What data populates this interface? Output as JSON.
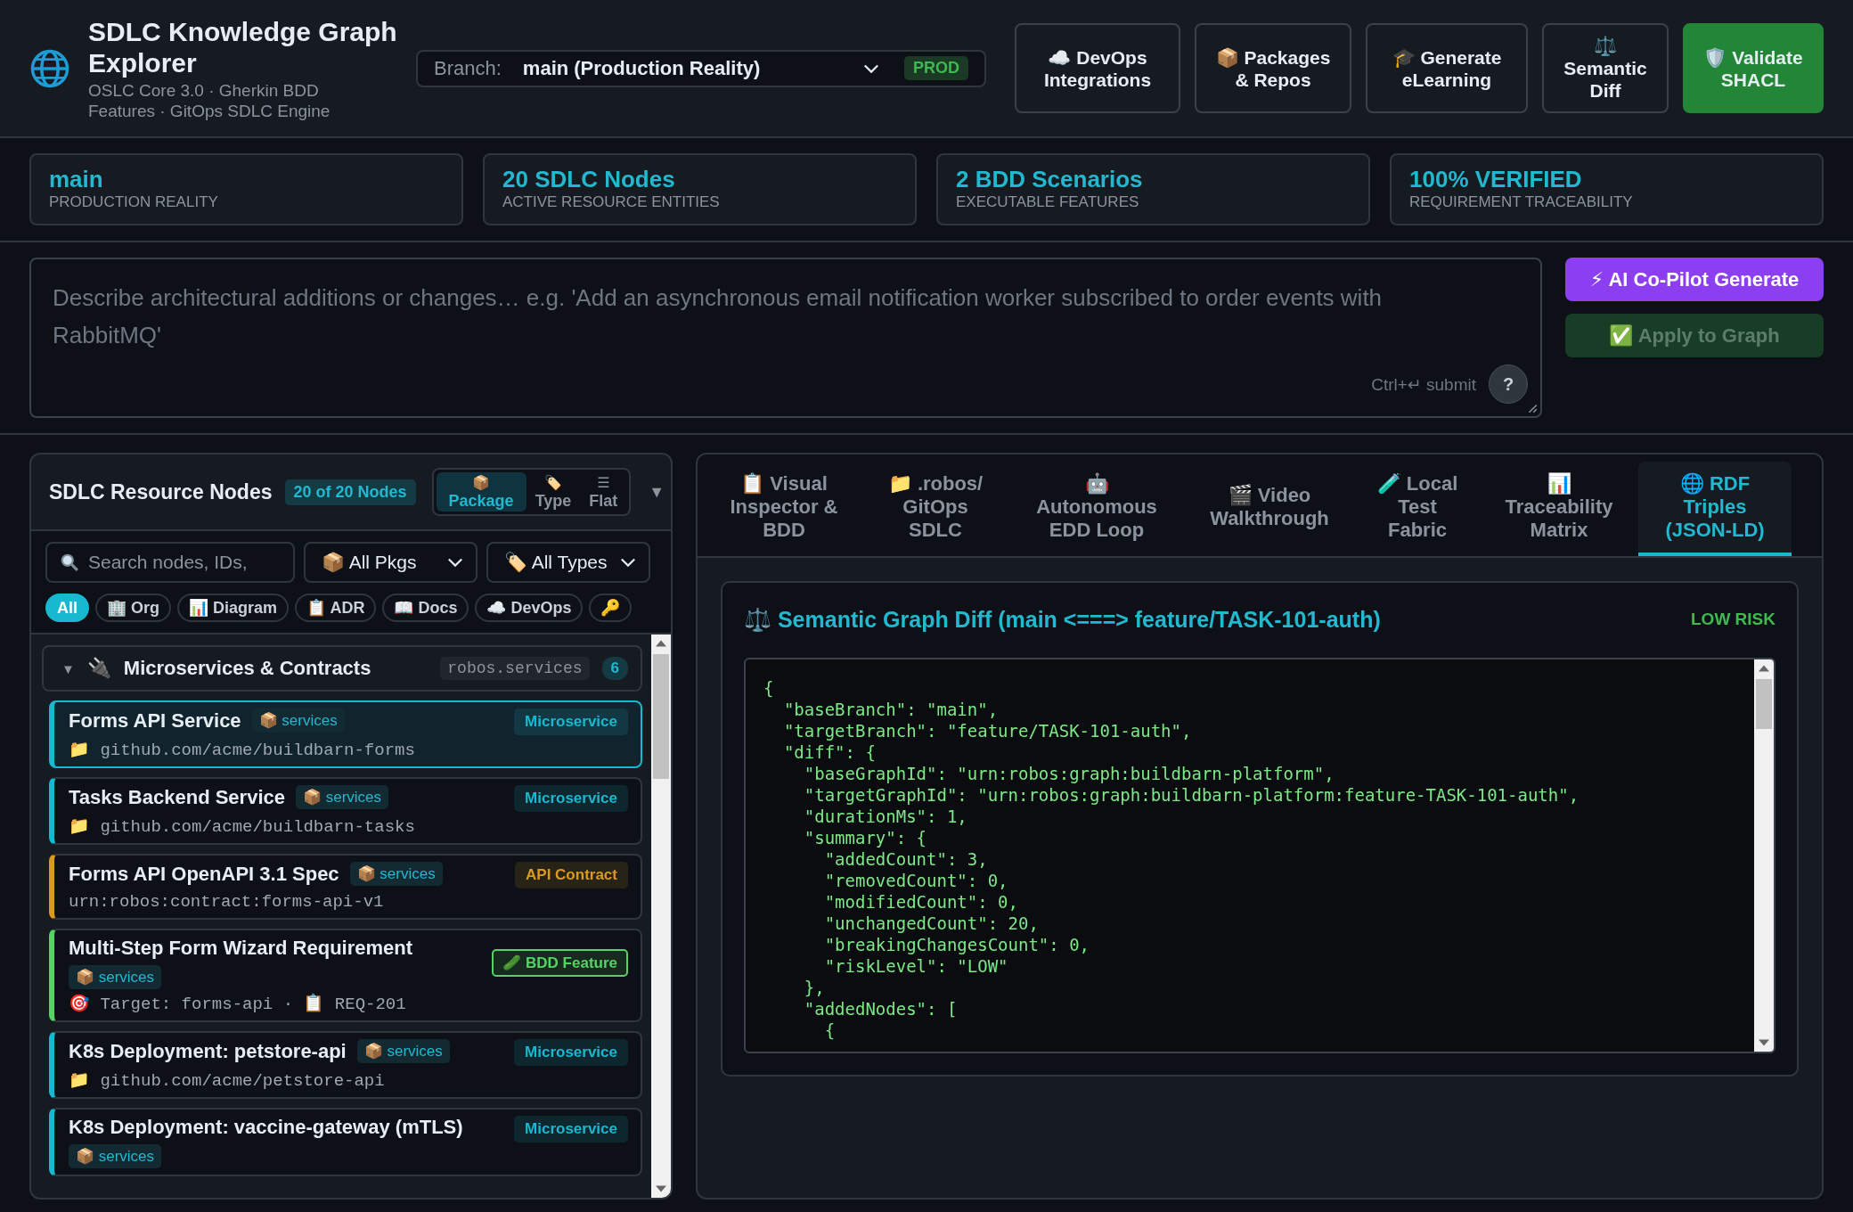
{
  "header": {
    "title": "SDLC Knowledge Graph Explorer",
    "subtitle": "OSLC Core 3.0 · Gherkin BDD Features · GitOps SDLC Engine",
    "branch": {
      "label": "Branch:",
      "value": "main (Production Reality)",
      "badge": "PROD"
    },
    "actions": [
      {
        "icon": "☁️",
        "label": "DevOps Integrations",
        "kind": "plain"
      },
      {
        "icon": "📦",
        "label": "Packages & Repos",
        "kind": "plain"
      },
      {
        "icon": "🎓",
        "label": "Generate eLearning",
        "kind": "plain"
      },
      {
        "icon": "⚖️",
        "label": "Semantic Diff",
        "kind": "plain"
      },
      {
        "icon": "🛡️",
        "label": "Validate SHACL",
        "kind": "primary"
      }
    ]
  },
  "stats": [
    {
      "value": "main",
      "label": "PRODUCTION REALITY"
    },
    {
      "value": "20 SDLC Nodes",
      "label": "ACTIVE RESOURCE ENTITIES"
    },
    {
      "value": "2 BDD Scenarios",
      "label": "EXECUTABLE FEATURES"
    },
    {
      "value": "100% VERIFIED",
      "label": "REQUIREMENT TRACEABILITY"
    }
  ],
  "prompt": {
    "placeholder": "Describe architectural additions or changes… e.g. 'Add an asynchronous email notification worker subscribed to order events with RabbitMQ'",
    "hint": "Ctrl+↵ submit",
    "help": "?",
    "buttons": [
      {
        "icon": "⚡",
        "label": "AI Co-Pilot Generate",
        "kind": "ai",
        "disabled": false
      },
      {
        "icon": "✅",
        "label": "Apply to Graph",
        "kind": "apply",
        "disabled": true
      }
    ]
  },
  "nodes_panel": {
    "title": "SDLC Resource Nodes",
    "count": "20 of 20 Nodes",
    "views": [
      {
        "icon": "📦",
        "label": "Package",
        "selected": true
      },
      {
        "icon": "🏷️",
        "label": "Type",
        "selected": false
      },
      {
        "icon": "☰",
        "label": "Flat",
        "selected": false
      }
    ],
    "collapse": "▼",
    "search": {
      "placeholder": "Search nodes, IDs,"
    },
    "filters": [
      {
        "icon": "📦",
        "value": "All Pkgs"
      },
      {
        "icon": "🏷️",
        "value": "All Types"
      }
    ],
    "chips": [
      {
        "label": "All",
        "selected": true
      },
      {
        "icon": "🏢",
        "label": "Org",
        "selected": false
      },
      {
        "icon": "📊",
        "label": "Diagram",
        "selected": false
      },
      {
        "icon": "📋",
        "label": "ADR",
        "selected": false
      },
      {
        "icon": "📖",
        "label": "Docs",
        "selected": false
      },
      {
        "icon": "☁️",
        "label": "DevOps",
        "selected": false
      },
      {
        "icon": "🔑",
        "selected": false
      }
    ],
    "groups": [
      {
        "expanded": true,
        "caret": "▼",
        "icon": "🔌",
        "title": "Microservices & Contracts",
        "namespace": "robos.services",
        "count": "6",
        "nodes": [
          {
            "title": "Forms API Service",
            "package_icon": "📦",
            "package": "services",
            "type": "Microservice",
            "color": "#17b8d0",
            "outlined": false,
            "selected": true,
            "meta_icon": "📁",
            "meta": "github.com/acme/buildbarn-forms"
          },
          {
            "title": "Tasks Backend Service",
            "package_icon": "📦",
            "package": "services",
            "type": "Microservice",
            "color": "#17b8d0",
            "outlined": false,
            "selected": false,
            "meta_icon": "📁",
            "meta": "github.com/acme/buildbarn-tasks"
          },
          {
            "title": "Forms API OpenAPI 3.1 Spec",
            "package_icon": "📦",
            "package": "services",
            "type": "API Contract",
            "color": "#d99a1e",
            "outlined": false,
            "selected": false,
            "meta": "urn:robos:contract:forms-api-v1"
          },
          {
            "title": "Multi-Step Form Wizard Requirement",
            "package_icon": "📦",
            "package": "services",
            "type_icon": "🥒",
            "type": "BDD Feature",
            "color": "#56d364",
            "outlined": true,
            "selected": false,
            "meta_icon": "🎯",
            "meta": "Target: forms-api · 📋 REQ-201"
          },
          {
            "title": "K8s Deployment: petstore-api",
            "package_icon": "📦",
            "package": "services",
            "type": "Microservice",
            "color": "#17b8d0",
            "outlined": false,
            "selected": false,
            "meta_icon": "📁",
            "meta": "github.com/acme/petstore-api"
          },
          {
            "title": "K8s Deployment: vaccine-gateway (mTLS)",
            "package_icon": "📦",
            "package": "services",
            "type": "Microservice",
            "color": "#17b8d0",
            "outlined": false,
            "selected": false
          }
        ]
      }
    ]
  },
  "detail": {
    "tabs": [
      {
        "icon": "📋",
        "label": "Visual Inspector & BDD",
        "selected": false
      },
      {
        "icon": "📁",
        "label": ".robos/ GitOps SDLC",
        "selected": false
      },
      {
        "icon": "🤖",
        "label": "Autonomous EDD Loop",
        "selected": false
      },
      {
        "icon": "🎬",
        "label": "Video Walkthrough",
        "selected": false
      },
      {
        "icon": "🧪",
        "label": "Local Test Fabric",
        "selected": false
      },
      {
        "icon": "📊",
        "label": "Traceability Matrix",
        "selected": false
      },
      {
        "icon": "🌐",
        "label": "RDF Triples (JSON-LD)",
        "selected": true
      }
    ],
    "diff": {
      "icon": "⚖️",
      "title": "Semantic Graph Diff (main <===> feature/TASK-101-auth)",
      "risk": "LOW RISK",
      "code": [
        "{",
        "  \"baseBranch\": \"main\",",
        "  \"targetBranch\": \"feature/TASK-101-auth\",",
        "  \"diff\": {",
        "    \"baseGraphId\": \"urn:robos:graph:buildbarn-platform\",",
        "    \"targetGraphId\": \"urn:robos:graph:buildbarn-platform:feature-TASK-101-auth\",",
        "    \"durationMs\": 1,",
        "    \"summary\": {",
        "      \"addedCount\": 3,",
        "      \"removedCount\": 0,",
        "      \"modifiedCount\": 0,",
        "      \"unchangedCount\": 20,",
        "      \"breakingChangesCount\": 0,",
        "      \"riskLevel\": \"LOW\"",
        "    },",
        "    \"addedNodes\": [",
        "      {"
      ]
    }
  }
}
